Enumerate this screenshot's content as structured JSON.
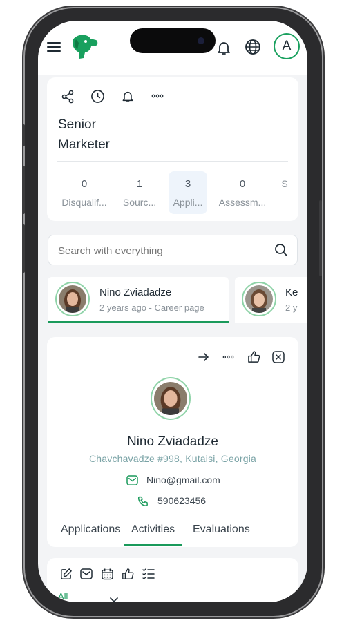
{
  "header": {
    "avatar_letter": "A",
    "icons": [
      "menu-icon",
      "dog-logo-icon",
      "bell-icon",
      "globe-icon"
    ]
  },
  "job": {
    "title_line1": "Senior",
    "title_line2": "Marketer",
    "actions": [
      "share-icon",
      "clock-icon",
      "bell-icon",
      "more-icon"
    ],
    "stages": [
      {
        "count": "0",
        "label": "Disqualif..."
      },
      {
        "count": "1",
        "label": "Sourc..."
      },
      {
        "count": "3",
        "label": "Appli..."
      },
      {
        "count": "0",
        "label": "Assessm..."
      },
      {
        "count": "",
        "label": "S"
      }
    ]
  },
  "search": {
    "placeholder": "Search with everything"
  },
  "candidates": [
    {
      "name": "Nino Zviadadze",
      "meta": "2 years ago - Career page"
    },
    {
      "name": "Ke",
      "meta": "2 y"
    }
  ],
  "profile": {
    "name": "Nino Zviadadze",
    "address": "Chavchavadze #998, Kutaisi, Georgia",
    "email": "Nino@gmail.com",
    "phone": "590623456",
    "tabs": [
      "Applications",
      "Activities",
      "Evaluations"
    ],
    "active_tab": "Activities"
  },
  "activities": {
    "filter_label": "All",
    "toolbar_icons": [
      "edit-icon",
      "mail-icon",
      "calendar-icon",
      "thumbs-up-icon",
      "checklist-icon"
    ]
  },
  "colors": {
    "accent": "#1a9a5b",
    "active_stage_bg": "#eef4fb",
    "address": "#7aa3a6"
  }
}
